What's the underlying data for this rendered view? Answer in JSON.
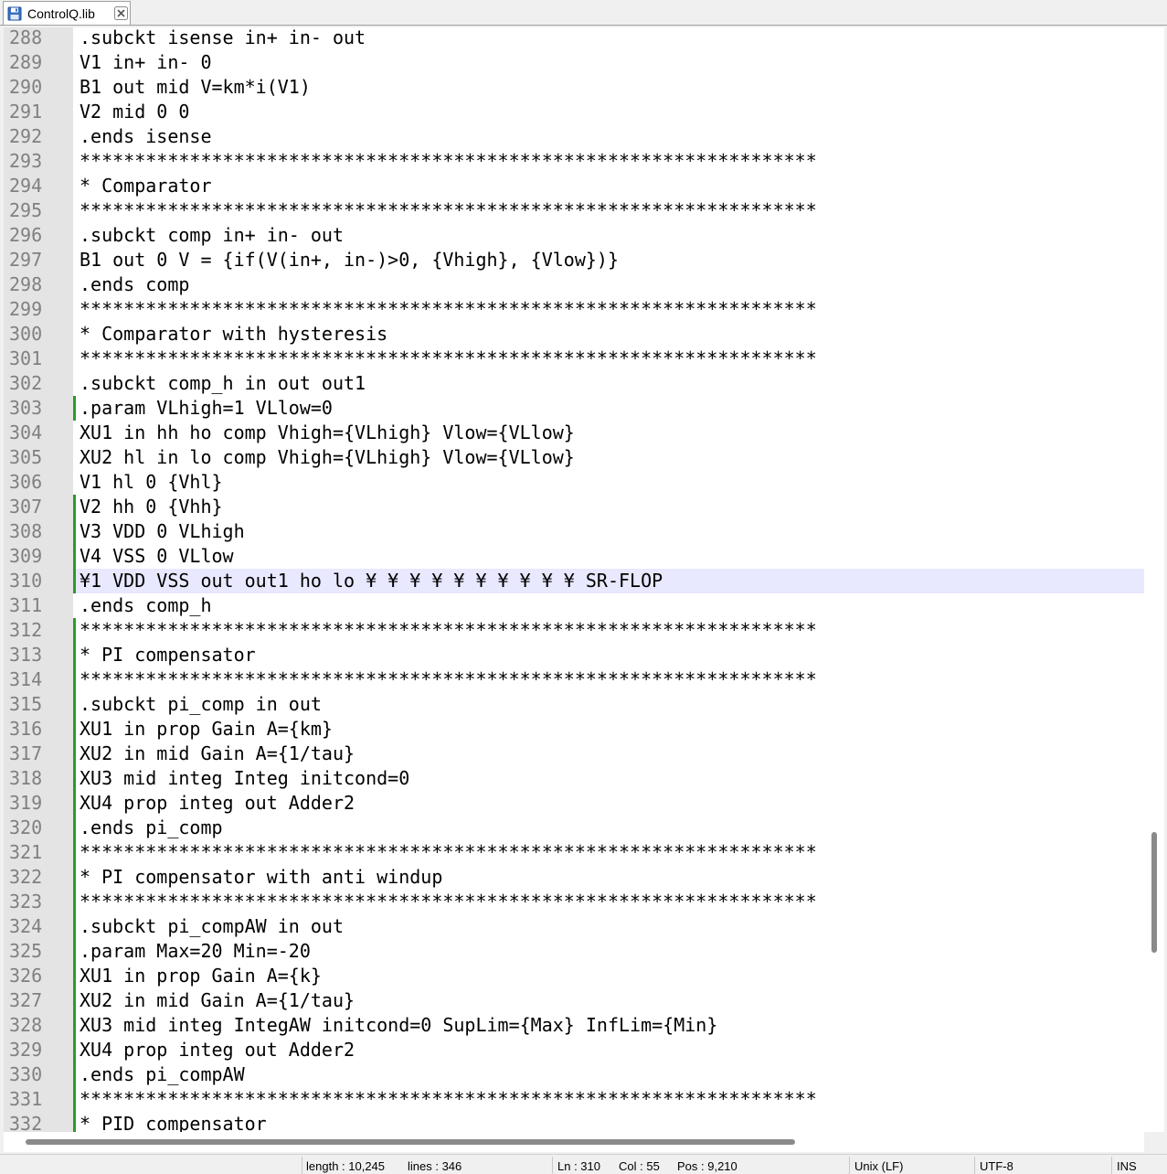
{
  "tab": {
    "label": "ControlQ.lib",
    "icon": "save-disk-icon",
    "close_icon": "close-icon"
  },
  "editor": {
    "current_line": "310",
    "lines": [
      {
        "num": "288",
        "text": ".subckt isense in+ in- out",
        "changed": false
      },
      {
        "num": "289",
        "text": "V1 in+ in- 0",
        "changed": false
      },
      {
        "num": "290",
        "text": "B1 out mid V=km*i(V1)",
        "changed": false
      },
      {
        "num": "291",
        "text": "V2 mid 0 0",
        "changed": false
      },
      {
        "num": "292",
        "text": ".ends isense",
        "changed": false
      },
      {
        "num": "293",
        "text": "*******************************************************************",
        "changed": false
      },
      {
        "num": "294",
        "text": "* Comparator",
        "changed": false
      },
      {
        "num": "295",
        "text": "*******************************************************************",
        "changed": false
      },
      {
        "num": "296",
        "text": ".subckt comp in+ in- out",
        "changed": false
      },
      {
        "num": "297",
        "text": "B1 out 0 V = {if(V(in+, in-)>0, {Vhigh}, {Vlow})}",
        "changed": false
      },
      {
        "num": "298",
        "text": ".ends comp",
        "changed": false
      },
      {
        "num": "299",
        "text": "*******************************************************************",
        "changed": false
      },
      {
        "num": "300",
        "text": "* Comparator with hysteresis",
        "changed": false
      },
      {
        "num": "301",
        "text": "*******************************************************************",
        "changed": false
      },
      {
        "num": "302",
        "text": ".subckt comp_h in out out1",
        "changed": false
      },
      {
        "num": "303",
        "text": ".param VLhigh=1 VLlow=0",
        "changed": true
      },
      {
        "num": "304",
        "text": "XU1 in hh ho comp Vhigh={VLhigh} Vlow={VLlow}",
        "changed": false
      },
      {
        "num": "305",
        "text": "XU2 hl in lo comp Vhigh={VLhigh} Vlow={VLlow}",
        "changed": false
      },
      {
        "num": "306",
        "text": "V1 hl 0 {Vhl}",
        "changed": false
      },
      {
        "num": "307",
        "text": "V2 hh 0 {Vhh}",
        "changed": true
      },
      {
        "num": "308",
        "text": "V3 VDD 0 VLhigh",
        "changed": true
      },
      {
        "num": "309",
        "text": "V4 VSS 0 VLlow",
        "changed": true
      },
      {
        "num": "310",
        "text": "¥1 VDD VSS out out1 ho lo ¥ ¥ ¥ ¥ ¥ ¥ ¥ ¥ ¥ ¥ SR-FLOP",
        "changed": true
      },
      {
        "num": "311",
        "text": ".ends comp_h",
        "changed": false
      },
      {
        "num": "312",
        "text": "*******************************************************************",
        "changed": true
      },
      {
        "num": "313",
        "text": "* PI compensator",
        "changed": true
      },
      {
        "num": "314",
        "text": "*******************************************************************",
        "changed": true
      },
      {
        "num": "315",
        "text": ".subckt pi_comp in out",
        "changed": true
      },
      {
        "num": "316",
        "text": "XU1 in prop Gain A={km}",
        "changed": true
      },
      {
        "num": "317",
        "text": "XU2 in mid Gain A={1/tau}",
        "changed": true
      },
      {
        "num": "318",
        "text": "XU3 mid integ Integ initcond=0",
        "changed": true
      },
      {
        "num": "319",
        "text": "XU4 prop integ out Adder2",
        "changed": true
      },
      {
        "num": "320",
        "text": ".ends pi_comp",
        "changed": true
      },
      {
        "num": "321",
        "text": "*******************************************************************",
        "changed": true
      },
      {
        "num": "322",
        "text": "* PI compensator with anti windup",
        "changed": true
      },
      {
        "num": "323",
        "text": "*******************************************************************",
        "changed": true
      },
      {
        "num": "324",
        "text": ".subckt pi_compAW in out",
        "changed": true
      },
      {
        "num": "325",
        "text": ".param Max=20 Min=-20",
        "changed": true
      },
      {
        "num": "326",
        "text": "XU1 in prop Gain A={k}",
        "changed": true
      },
      {
        "num": "327",
        "text": "XU2 in mid Gain A={1/tau}",
        "changed": true
      },
      {
        "num": "328",
        "text": "XU3 mid integ IntegAW initcond=0 SupLim={Max} InfLim={Min}",
        "changed": true
      },
      {
        "num": "329",
        "text": "XU4 prop integ out Adder2",
        "changed": true
      },
      {
        "num": "330",
        "text": ".ends pi_compAW",
        "changed": true
      },
      {
        "num": "331",
        "text": "*******************************************************************",
        "changed": true
      },
      {
        "num": "332",
        "text": "* PID compensator",
        "changed": true
      }
    ]
  },
  "status": {
    "length": "length : 10,245",
    "lines": "lines : 346",
    "ln": "Ln : 310",
    "col": "Col : 55",
    "pos": "Pos : 9,210",
    "eol": "Unix (LF)",
    "encoding": "UTF-8",
    "mode": "INS"
  },
  "colors": {
    "current_line_bg": "#e8e8ff",
    "change_bar": "#2e9a2e",
    "gutter_bg": "#e4e4e4",
    "line_number_fg": "#808080"
  }
}
